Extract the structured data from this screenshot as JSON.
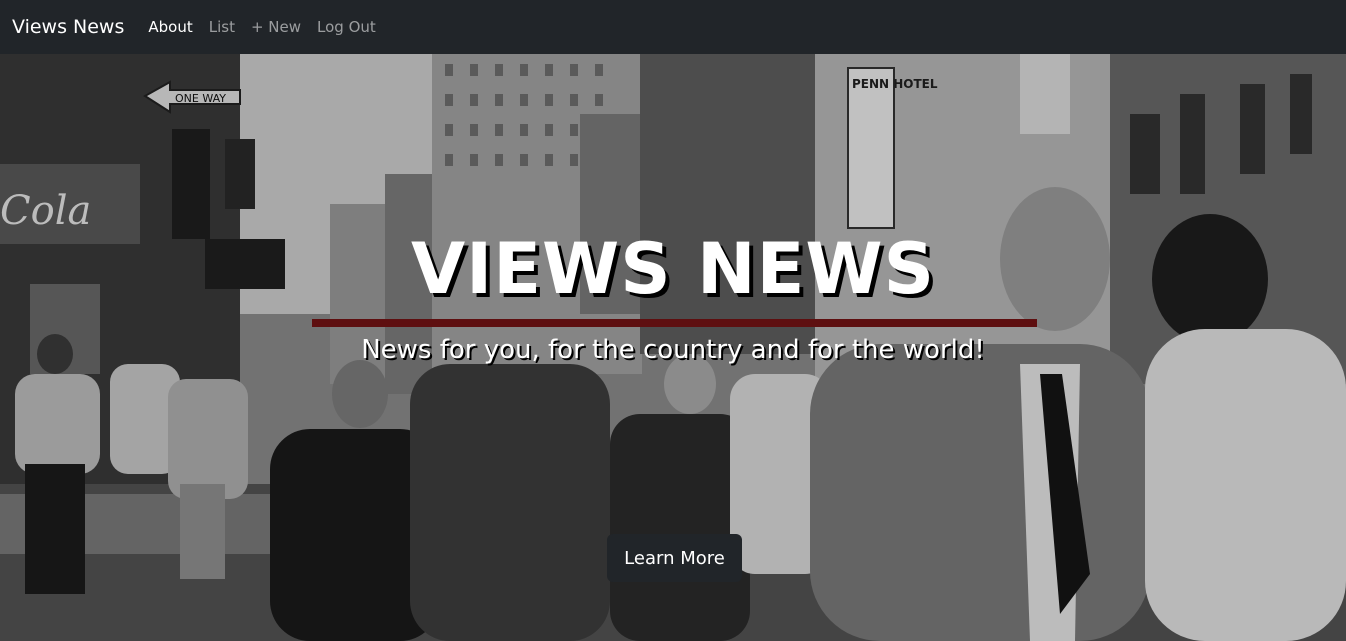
{
  "navbar": {
    "brand": "Views News",
    "links": [
      {
        "label": "About"
      },
      {
        "label": "List"
      },
      {
        "label": "+ New"
      },
      {
        "label": "Log Out"
      }
    ]
  },
  "hero": {
    "title": "VIEWS NEWS",
    "subtitle": "News for you, for the country and for the world!",
    "button_label": "Learn More",
    "image_alt": "Black-and-white photo of a crowded city street",
    "image_signs": [
      "ONE WAY",
      "Cola",
      "PENN HOTEL"
    ]
  },
  "colors": {
    "navbar_bg": "#212529",
    "rule": "#5e0f10",
    "button_bg": "#212529"
  }
}
